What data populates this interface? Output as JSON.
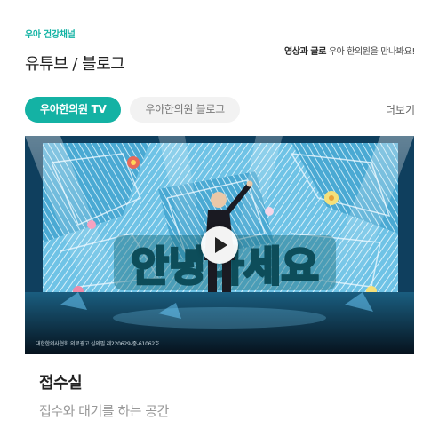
{
  "section": {
    "eyebrow": "우아 건강채널",
    "title": "유튜브 / 블로그",
    "tagline_bold": "영상과 글로",
    "tagline_rest": " 우아 한의원을 만나봐요!",
    "more_label": "더보기"
  },
  "tabs": [
    {
      "label": "우아한의원 TV",
      "active": true
    },
    {
      "label": "우아한의원 블로그",
      "active": false
    }
  ],
  "video": {
    "thumbnail_text": "안녕하세요",
    "caption": "대한한의사협회 의료광고 심의필 제220629-중-61062호",
    "play_icon": "play-icon"
  },
  "card": {
    "name": "접수실",
    "description": "접수와 대기를 하는 공간"
  },
  "colors": {
    "accent": "#14b2a4",
    "inactive_tab_bg": "#f2f2f2"
  }
}
